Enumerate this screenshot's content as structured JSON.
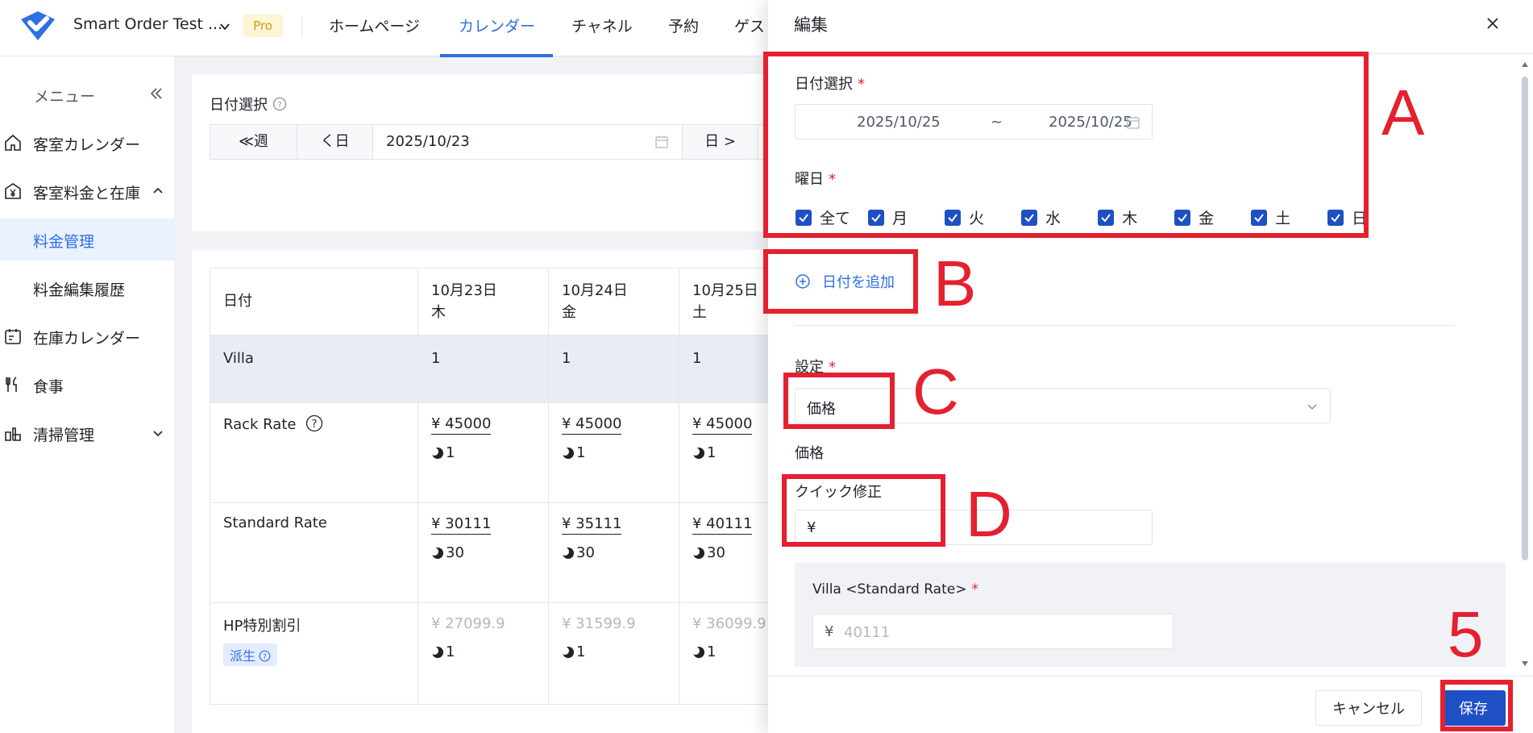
{
  "header": {
    "app_name": "Smart Order Test ...",
    "badge": "Pro",
    "tabs": [
      "ホームページ",
      "カレンダー",
      "チャネル",
      "予約",
      "ゲス"
    ],
    "active_tab": "カレンダー",
    "accent_color": "#2f6fe4"
  },
  "sidebar": {
    "title": "メニュー",
    "items": [
      {
        "label": "客室カレンダー",
        "icon": "home-icon"
      },
      {
        "label": "客室料金と在庫",
        "icon": "yen-icon"
      },
      {
        "label": "料金管理",
        "active": true
      },
      {
        "label": "料金編集履歴"
      },
      {
        "label": "在庫カレンダー",
        "icon": "calendar-icon"
      },
      {
        "label": "食事",
        "icon": "fork-knife-icon"
      },
      {
        "label": "清掃管理",
        "icon": "cleaning-icon"
      }
    ]
  },
  "main": {
    "date_select_label": "日付選択",
    "date_bar": {
      "prev_week": "≪週",
      "prev_day": "く日",
      "date": "2025/10/23",
      "next_day": "日 >"
    },
    "table": {
      "header_label": "日付",
      "columns": [
        {
          "date": "10月23日",
          "weekday": "木"
        },
        {
          "date": "10月24日",
          "weekday": "金"
        },
        {
          "date": "10月25日",
          "weekday": "土"
        }
      ],
      "villa": {
        "label": "Villa",
        "values": [
          "1",
          "1",
          "1"
        ]
      },
      "rack": {
        "label": "Rack Rate",
        "prices": [
          "¥ 45000",
          "¥ 45000",
          "¥ 45000"
        ],
        "stock": [
          "1",
          "1",
          "1"
        ]
      },
      "standard": {
        "label": "Standard Rate",
        "prices": [
          "¥ 30111",
          "¥ 35111",
          "¥ 40111"
        ],
        "stock": [
          "30",
          "30",
          "30"
        ]
      },
      "hp": {
        "label": "HP特別割引",
        "badge": "派生",
        "prices": [
          "¥ 27099.9",
          "¥ 31599.9",
          "¥ 36099.9"
        ],
        "stock": [
          "1",
          "1",
          "1"
        ]
      }
    }
  },
  "drawer": {
    "title": "編集",
    "date_label": "日付選択",
    "required_mark": "*",
    "start_date": "2025/10/25",
    "range_sep": "~",
    "end_date": "2025/10/25",
    "weekday_label": "曜日",
    "weekdays": [
      "全て",
      "月",
      "火",
      "水",
      "木",
      "金",
      "土",
      "日"
    ],
    "add_date": "日付を追加",
    "setting_label": "設定",
    "setting_value": "価格",
    "price_label": "価格",
    "quick_fix_label": "クイック修正",
    "yen": "¥",
    "villa_label": "Villa <Standard Rate>",
    "villa_placeholder": "40111",
    "cancel": "キャンセル",
    "save": "保存"
  },
  "annotations": [
    "A",
    "B",
    "C",
    "D",
    "5"
  ]
}
